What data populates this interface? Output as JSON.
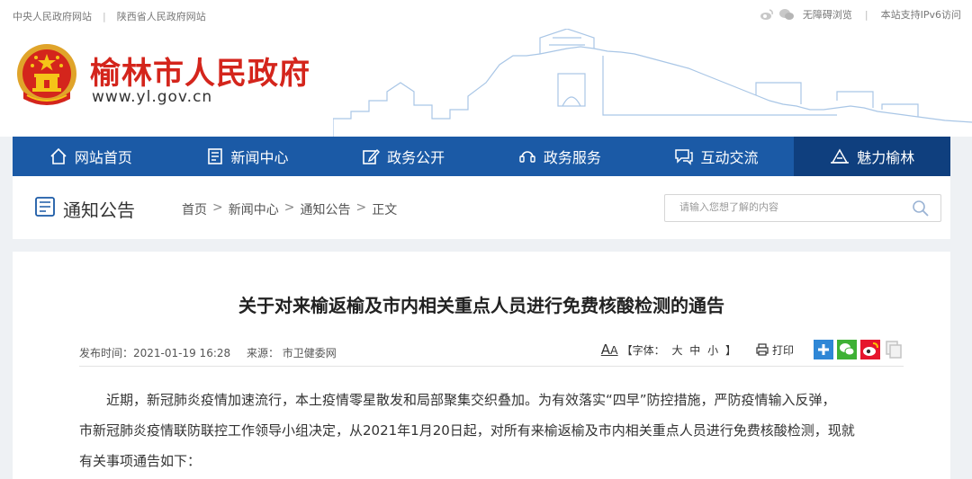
{
  "topbar": {
    "link_central": "中央人民政府网站",
    "link_province": "陕西省人民政府网站",
    "accessibility": "无障碍浏览",
    "ipv6": "本站支持IPv6访问"
  },
  "header": {
    "title": "榆林市人民政府",
    "url": "www.yl.gov.cn"
  },
  "nav": {
    "items": [
      {
        "label": "网站首页",
        "icon": "home-icon"
      },
      {
        "label": "新闻中心",
        "icon": "news-icon"
      },
      {
        "label": "政务公开",
        "icon": "edit-icon"
      },
      {
        "label": "政务服务",
        "icon": "service-icon"
      },
      {
        "label": "互动交流",
        "icon": "chat-icon"
      },
      {
        "label": "魅力榆林",
        "icon": "landmark-icon"
      }
    ],
    "active_index": 5
  },
  "section": {
    "title": "通知公告",
    "breadcrumb": [
      "首页",
      "新闻中心",
      "通知公告",
      "正文"
    ],
    "breadcrumb_sep": ">"
  },
  "search": {
    "placeholder": "请输入您想了解的内容"
  },
  "article": {
    "title": "关于对来榆返榆及市内相关重点人员进行免费核酸检测的通告",
    "publish_time": "发布时间：2021-01-19 16:28",
    "source": "来源：  市卫健委网",
    "font_label": "【字体：",
    "font_large": "大",
    "font_medium": "中",
    "font_small": "小",
    "font_end": "】",
    "print_label": "打印",
    "paragraph_1": "近期，新冠肺炎疫情加速流行，本土疫情零星散发和局部聚集交织叠加。为有效落实“四早”防控措施，严防疫情输入反弹，",
    "paragraph_2": "市新冠肺炎疫情联防联控工作领导小组决定，从2021年1月20日起，对所有来榆返榆及市内相关重点人员进行免费核酸检测，现就",
    "paragraph_3": "有关事项通告如下："
  },
  "colors": {
    "brand_red": "#d4251c",
    "nav_blue": "#1b5aa6",
    "nav_active": "#0f3f7e"
  }
}
